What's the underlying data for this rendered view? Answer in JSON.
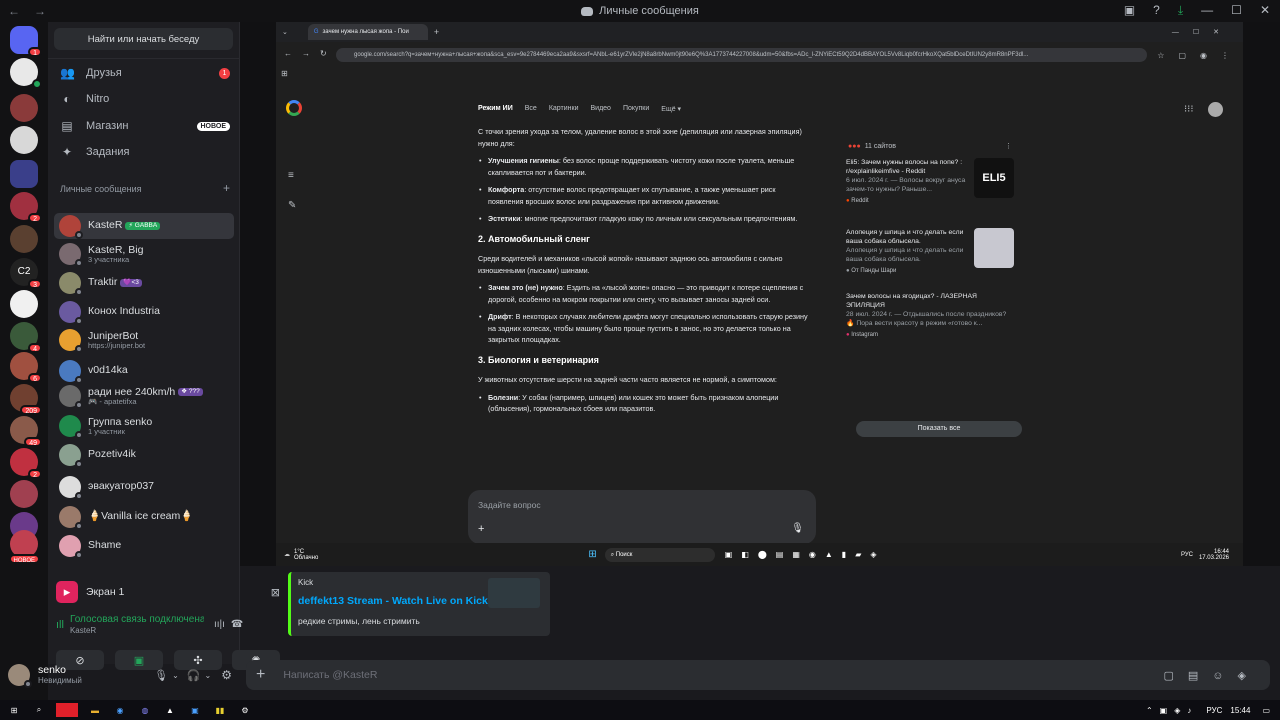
{
  "window": {
    "title": "Личные сообщения"
  },
  "sidebar": {
    "find_button": "Найти или начать беседу",
    "nav": [
      {
        "label": "Друзья",
        "icon": "friends-icon",
        "badge": "1"
      },
      {
        "label": "Nitro",
        "icon": "nitro-icon"
      },
      {
        "label": "Магазин",
        "icon": "shop-icon",
        "tag": "НОВОЕ"
      },
      {
        "label": "Задания",
        "icon": "quests-icon"
      }
    ],
    "dm_header": "Личные сообщения",
    "dms": [
      {
        "name": "KasteR",
        "tag": "⚡ GABBA",
        "sub": "",
        "color": "#b0433a"
      },
      {
        "name": "KasteR, Big",
        "tag": "",
        "sub": "3 участника",
        "color": "#7a6a70"
      },
      {
        "name": "Traktir",
        "tag": "💜<3",
        "sub": "",
        "color": "#8a8a6a"
      },
      {
        "name": "Конох Industria",
        "tag": "",
        "sub": "",
        "color": "#6a5aa0"
      },
      {
        "name": "JuniperBot",
        "tag": "",
        "sub": "https://juniper.bot",
        "color": "#e8a030"
      },
      {
        "name": "v0d14ka",
        "tag": "",
        "sub": "",
        "color": "#4a7ac0"
      },
      {
        "name": "ради нее 240km/h",
        "tag": "❖ ???",
        "sub": "🎮 - apatetifxa",
        "color": "#6a6a6a"
      },
      {
        "name": "Группа senko",
        "tag": "",
        "sub": "1 участник",
        "color": "#1f8a4c"
      },
      {
        "name": "Pozetiv4ik",
        "tag": "",
        "sub": "",
        "color": "#8aa090"
      },
      {
        "name": "эвакуатор037",
        "tag": "",
        "sub": "",
        "color": "#dddddd"
      },
      {
        "name": "🍦Vanilla ice cream🍦",
        "tag": "",
        "sub": "",
        "color": "#9a7a6a"
      },
      {
        "name": "Shame",
        "tag": "",
        "sub": "",
        "color": "#e0a0b0"
      }
    ]
  },
  "voice": {
    "screen_label": "Экран 1",
    "status": "Голосовая связь подключена",
    "channel": "KasteR"
  },
  "user": {
    "name": "senko",
    "status": "Невидимый"
  },
  "stream": {
    "tab_title": "зачем нужна лысая жопа - Пои",
    "url": "google.com/search?q=зачем+нужна+лысая+жопа&sca_esv=9e2784469eca2aa9&sxsrf=ANbL-e61yrZVle2jN8a8rbNwm0jt90e6Q%3A1773744227008&udm=50&fbs=ADc_l-ZNYiECt59Q2D4dBBAYOL5Vv8Liqb0fcrHkoXQat5blDceDtIUN2y8mR8nPF3dl...",
    "google_nav": [
      "Режим ИИ",
      "Все",
      "Картинки",
      "Видео",
      "Покупки",
      "Ещё ▾"
    ],
    "article": {
      "intro": "С точки зрения ухода за телом, удаление волос в этой зоне (депиляция или лазерная эпиляция) нужно для:",
      "bullets1": [
        {
          "b": "Улучшения гигиены",
          "t": ": без волос проще поддерживать чистоту кожи после туалета, меньше скапливается пот и бактерии."
        },
        {
          "b": "Комфорта",
          "t": ": отсутствие волос предотвращает их спутывание, а также уменьшает риск появления вросших волос или раздражения при активном движении."
        },
        {
          "b": "Эстетики",
          "t": ": многие предпочитают гладкую кожу по личным или сексуальным предпочтениям."
        }
      ],
      "h2": "2. Автомобильный сленг",
      "p2": "Среди водителей и механиков «лысой жопой» называют заднюю ось автомобиля с сильно изношенными (лысыми) шинами.",
      "bullets2": [
        {
          "b": "Зачем это (не) нужно",
          "t": ": Ездить на «лысой жопе» опасно — это приводит к потере сцепления с дорогой, особенно на мокром покрытии или снегу, что вызывает заносы задней оси."
        },
        {
          "b": "Дрифт",
          "t": ": В некоторых случаях любители дрифта могут специально использовать старую резину на задних колесах, чтобы машину было проще пустить в занос, но это делается только на закрытых площадках."
        }
      ],
      "h3": "3. Биология и ветеринария",
      "p3": "У животных отсутствие шерсти на задней части часто является не нормой, а симптомом:",
      "bullets3": [
        {
          "b": "Болезни",
          "t": ": У собак (например, шпицев) или кошек это может быть признаком алопеции (облысения), гормональных сбоев или паразитов."
        }
      ]
    },
    "sources": {
      "count": "11 сайтов",
      "items": [
        {
          "title": "Eli5: Зачем нужны волосы на попе? : r/explainlikeimfive - Reddit",
          "desc": "6 июл. 2024 г. — Волосы вокруг ануса зачем-то нужны? Раньше...",
          "origin": "Reddit",
          "thumb": "ELI5"
        },
        {
          "title": "Алопеция у шпица и что делать если ваша собака облысела.",
          "desc": "Алопеция у шпица и что делать если ваша собака облысела.",
          "origin": "От Панды Шари",
          "thumb": ""
        },
        {
          "title": "Зачем волосы на ягодицах? - ЛАЗЕРНАЯ ЭПИЛЯЦИЯ",
          "desc": "28 июл. 2024 г. — Отдышались после праздников? 🔥 Пора вести красоту в режим «готово к...",
          "origin": "Instagram",
          "thumb": ""
        }
      ],
      "show_all": "Показать все"
    },
    "ask_placeholder": "Задайте вопрос",
    "taskbar": {
      "weather_temp": "1°C",
      "weather_desc": "Облачно",
      "search": "Поиск",
      "lang": "РУС",
      "time": "16:44",
      "date": "17.03.2026"
    }
  },
  "embed": {
    "provider": "Kick",
    "title": "deffekt13 Stream - Watch Live on Kick",
    "description": "редкие стримы, лень стримить"
  },
  "chat": {
    "placeholder": "Написать @KasteR"
  },
  "taskbar": {
    "lang": "РУС",
    "time": "15:44"
  },
  "rail_badges": [
    "1",
    "2",
    "3",
    "4",
    "3",
    "6",
    "209",
    "49",
    "2",
    "НОВОЕ"
  ],
  "colors": {
    "accent": "#5865f2",
    "green": "#23a55a",
    "red": "#f23f43"
  }
}
